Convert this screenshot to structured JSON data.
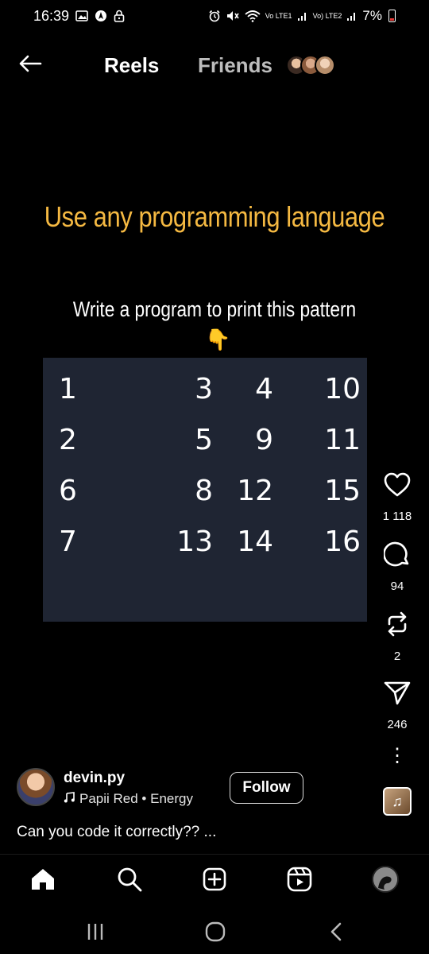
{
  "status_bar": {
    "time": "16:39",
    "battery_percent": "7%",
    "left_icons": [
      "gallery-icon",
      "navigation-icon",
      "lock-icon"
    ],
    "right_icons": [
      "alarm-icon",
      "mute-icon",
      "wifi-icon",
      "signal-icon",
      "signal-icon",
      "battery-icon"
    ],
    "net1_label": "Vo LTE1",
    "net2_label": "Vo) LTE2"
  },
  "top_nav": {
    "back_icon": "arrow-left-icon",
    "tab_reels": "Reels",
    "tab_friends": "Friends"
  },
  "reel": {
    "headline": "Use any programming language",
    "subline": "Write a program to print this pattern",
    "pointer_emoji": "👇",
    "pattern": [
      [
        "1",
        "3",
        "4",
        "10"
      ],
      [
        "2",
        "5",
        "9",
        "11"
      ],
      [
        "6",
        "8",
        "12",
        "15"
      ],
      [
        "7",
        "13",
        "14",
        "16"
      ]
    ]
  },
  "actions": {
    "likes": "1 118",
    "comments": "94",
    "reposts": "2",
    "shares": "246",
    "more": "⋮"
  },
  "author": {
    "username": "devin.py",
    "sound": "Papii Red • Energy",
    "follow_label": "Follow",
    "caption": "Can you code it correctly?? ..."
  },
  "bottom_tabs": [
    "home-icon",
    "search-icon",
    "create-icon",
    "reels-icon",
    "profile-avatar"
  ],
  "colors": {
    "headline": "#f5b942",
    "pattern_bg": "#1f2533",
    "background": "#000000"
  }
}
